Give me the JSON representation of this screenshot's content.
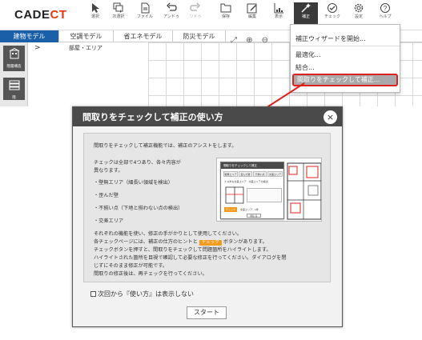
{
  "app": {
    "logo_main": "CADE",
    "logo_accent": "CT"
  },
  "toolbar": {
    "items": [
      {
        "label": "選択",
        "icon": "cursor-icon"
      },
      {
        "label": "次選択",
        "icon": "multi-select-icon"
      },
      {
        "label": "ファイル",
        "icon": "file-icon"
      },
      {
        "label": "アンドゥ",
        "icon": "undo-icon"
      },
      {
        "label": "リドゥ",
        "icon": "redo-icon"
      },
      {
        "label": "保存",
        "icon": "save-icon"
      },
      {
        "label": "編集",
        "icon": "edit-icon"
      },
      {
        "label": "表示",
        "icon": "display-icon"
      },
      {
        "label": "補正",
        "icon": "magic-wand-icon"
      },
      {
        "label": "チェック",
        "icon": "check-icon"
      },
      {
        "label": "設定",
        "icon": "gear-icon"
      },
      {
        "label": "ヘルプ",
        "icon": "help-icon"
      }
    ]
  },
  "tabs": [
    {
      "label": "建物モデル"
    },
    {
      "label": "空調モデル"
    },
    {
      "label": "省エネモデル"
    },
    {
      "label": "防災モデル"
    }
  ],
  "left_panel": {
    "btn1": "階層構造",
    "btn2": "階"
  },
  "room_label": "部屋・エリア",
  "dropdown": {
    "wizard": "補正ウィザードを開始...",
    "simplify": "最適化...",
    "merge": "結合...",
    "check_fix": "間取りをチェックして補正..."
  },
  "dialog": {
    "title": "間取りをチェックして補正の使い方",
    "close": "×",
    "intro": "間取りをチェックして補正機能では、補正のアシストをします。",
    "check_a": "チェックは全部で4つあり、各々内容が",
    "check_b": "異なります。",
    "items": [
      "・壁無エリア（細長い領域を検出）",
      "・歪んだ壁",
      "・不揃い点（下地と揃わない点の検出）",
      "・交差エリア"
    ],
    "p1": "それぞれの機能を使い、修正の手がかりとして使用してください。",
    "p2a": "各チェックページには、補正の仕方のヒントと",
    "badge": "チェック",
    "p2b": "ボタンがあります。",
    "p3": "チェックボタンを押すと、間取りをチェックして問題箇所をハイライトします。",
    "p4": "ハイライトされた箇所を目視で確認して必要な修正を行ってください。ダイアログを閉",
    "p5": "じずにそのまま修正が可能です。",
    "p6": "間取りの修正後は、再チェックを行ってください。",
    "dont_show": "次回から『使い方』は表示しない",
    "start": "スタート",
    "illustration": {
      "head": "間取りをチェックして補正",
      "tab1": "壁無エリア",
      "tab2": "歪んだ壁",
      "tab3": "不揃い点",
      "tab4": "交差エリア",
      "row1": "① 以外な交差エリア　交差エリアの検出",
      "badge": "チェック",
      "footer": "交差エリア：1件",
      "btn": "閉じる"
    }
  }
}
